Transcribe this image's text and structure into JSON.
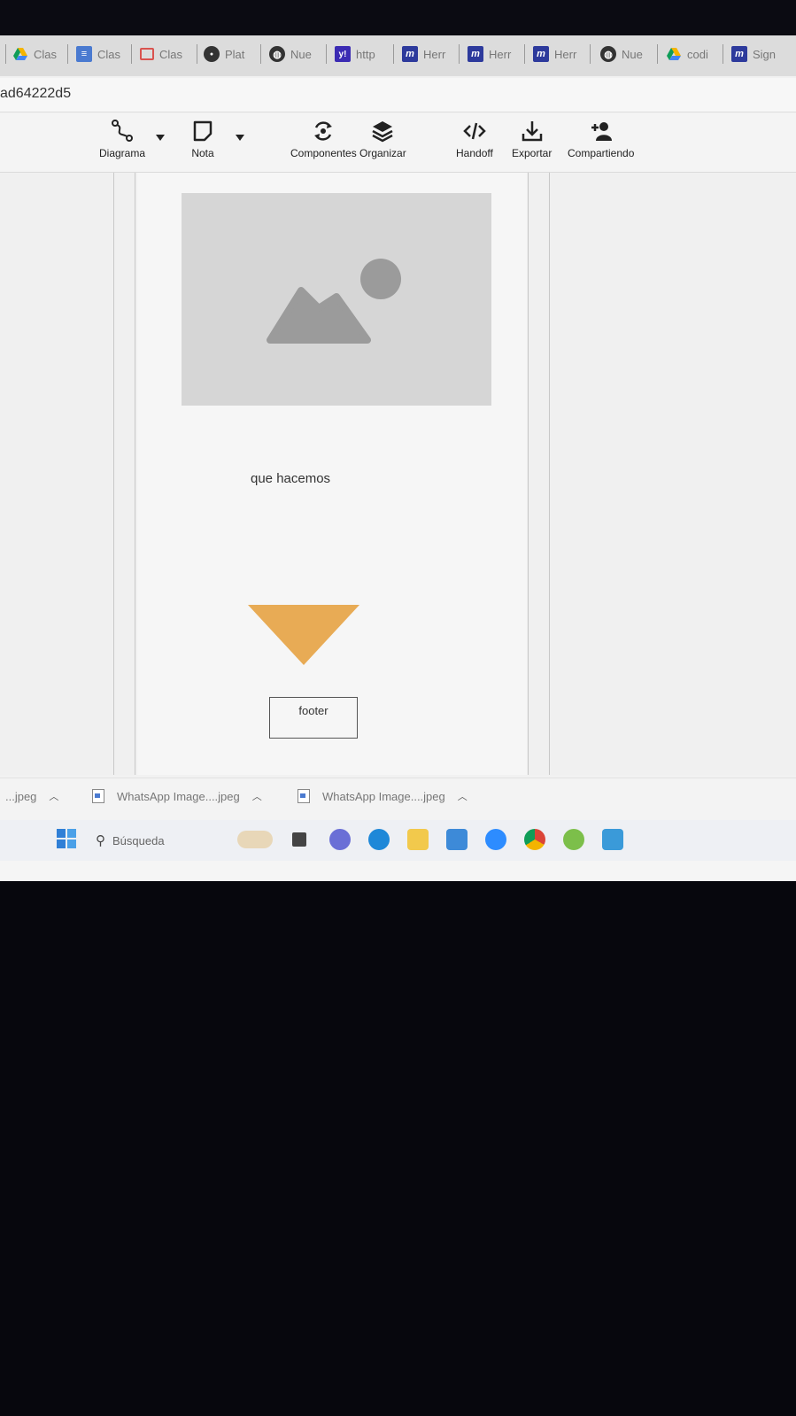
{
  "tabs": [
    {
      "label": "Clas",
      "icon": "google-drive-icon",
      "color": "#2f6fe0"
    },
    {
      "label": "Clas",
      "icon": "google-docs-icon",
      "color": "#4a7ad0"
    },
    {
      "label": "Clas",
      "icon": "slides-icon",
      "color": "#d9534f"
    },
    {
      "label": "Plat",
      "icon": "platform-icon",
      "color": "#333333"
    },
    {
      "label": "Nue",
      "icon": "globe-icon",
      "color": "#333333"
    },
    {
      "label": "http",
      "icon": "yahoo-icon",
      "color": "#3b2bb3"
    },
    {
      "label": "Herr",
      "icon": "m-app-icon",
      "color": "#2d3a9c"
    },
    {
      "label": "Herr",
      "icon": "m-app-icon",
      "color": "#2d3a9c"
    },
    {
      "label": "Herr",
      "icon": "m-app-icon",
      "color": "#2d3a9c"
    },
    {
      "label": "Nue",
      "icon": "globe-icon",
      "color": "#333333"
    },
    {
      "label": "codi",
      "icon": "google-drive-icon",
      "color": "#2f6fe0"
    },
    {
      "label": "Sign",
      "icon": "m-app-icon",
      "color": "#2d3a9c"
    }
  ],
  "address": {
    "text": "ad64222d5"
  },
  "toolbar": {
    "diagram": "Diagrama",
    "note": "Nota",
    "components": "Componentes",
    "arrange": "Organizar",
    "handoff": "Handoff",
    "export": "Exportar",
    "share": "Compartiendo"
  },
  "canvas": {
    "text": "que hacemos",
    "footer": "footer",
    "triangle_color": "#e8ab55"
  },
  "downloads": [
    {
      "label": "...jpeg"
    },
    {
      "label": "WhatsApp Image....jpeg"
    },
    {
      "label": "WhatsApp Image....jpeg"
    }
  ],
  "taskbar": {
    "search_placeholder": "Búsqueda"
  }
}
